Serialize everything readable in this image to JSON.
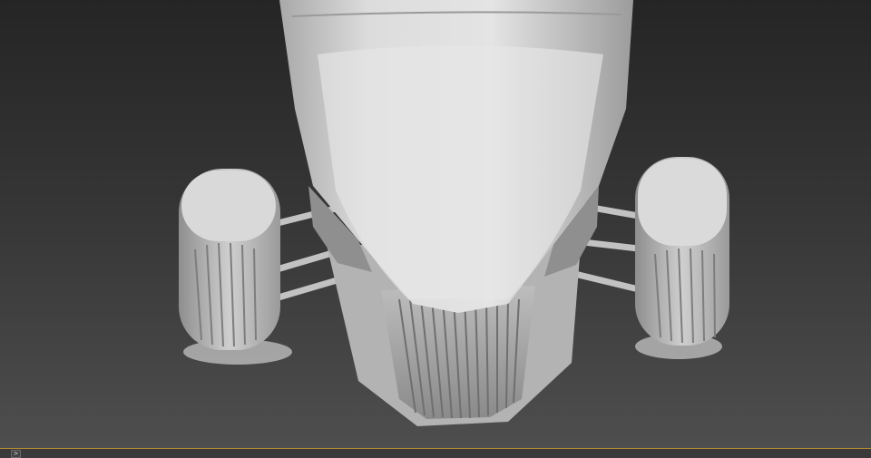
{
  "viewport": {
    "background_top": "#252525",
    "background_bottom": "#4e4e4e",
    "model_shade": "#d6d6d6"
  },
  "timeline": {
    "toggle_glyph": ">",
    "accent": "#b28c2e"
  }
}
